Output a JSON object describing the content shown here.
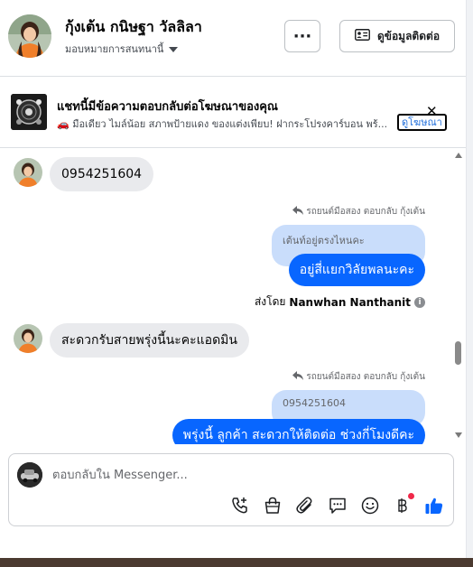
{
  "header": {
    "contact_name": "กุ้งเต้น กนิษฐา วัลลิลา",
    "assign_label": "มอบหมายการสนทนานี้",
    "more_label": "···",
    "contact_info_label": "ดูข้อมูลติดต่อ"
  },
  "ad_banner": {
    "title": "แชทนี้มีข้อความตอบกลับต่อโฆษณาของคุณ",
    "body": "🚗 มือเดียว ไมล์น้อย สภาพป้ายแดง ของแต่งเพียบ! ฝากระโปรงคาร์บอน พร้...",
    "view_ad_label": "ดูโฆษณา",
    "close_label": "✕"
  },
  "messages": {
    "incoming_1": "0954251604",
    "reply_note_1": "รถยนต์มือสอง ตอบกลับ กุ้งเต้น",
    "quoted_1": "เต้นท์อยู่ตรงไหนคะ",
    "outgoing_1": "อยู่สี่แยกวิลัยพลนะคะ",
    "sent_by_prefix": "ส่งโดย",
    "sent_by_name": "Nanwhan Nanthanit",
    "incoming_2": "สะดวกรับสายพรุ่งนี้นะคะแอดมิน",
    "reply_note_2": "รถยนต์มือสอง ตอบกลับ กุ้งเต้น",
    "quoted_2": "0954251604",
    "outgoing_2": "พรุ่งนี้ ลูกค้า สะดวกให้ติดต่อ ช่วงกี่โมงดีคะ"
  },
  "composer": {
    "placeholder": "ตอบกลับใน Messenger...",
    "value": ""
  },
  "colors": {
    "outgoing_bubble": "#0866ff",
    "quoted_bubble": "#c9ddfb",
    "incoming_bubble": "#e9eaed",
    "like_icon": "#0866ff",
    "notification_dot": "#f02849"
  },
  "icons": {
    "header_avatar": "profile-photo-avatar",
    "contact_card": "contact-card-icon",
    "reply_arrow": "reply-arrow-icon",
    "info": "info-icon",
    "call_add": "phone-plus-icon",
    "shopping_bag": "shopping-bag-icon",
    "attachment": "paperclip-icon",
    "saved_replies": "chat-bubble-icon",
    "emoji": "smiley-icon",
    "payment": "baht-icon",
    "like": "thumbs-up-icon"
  }
}
